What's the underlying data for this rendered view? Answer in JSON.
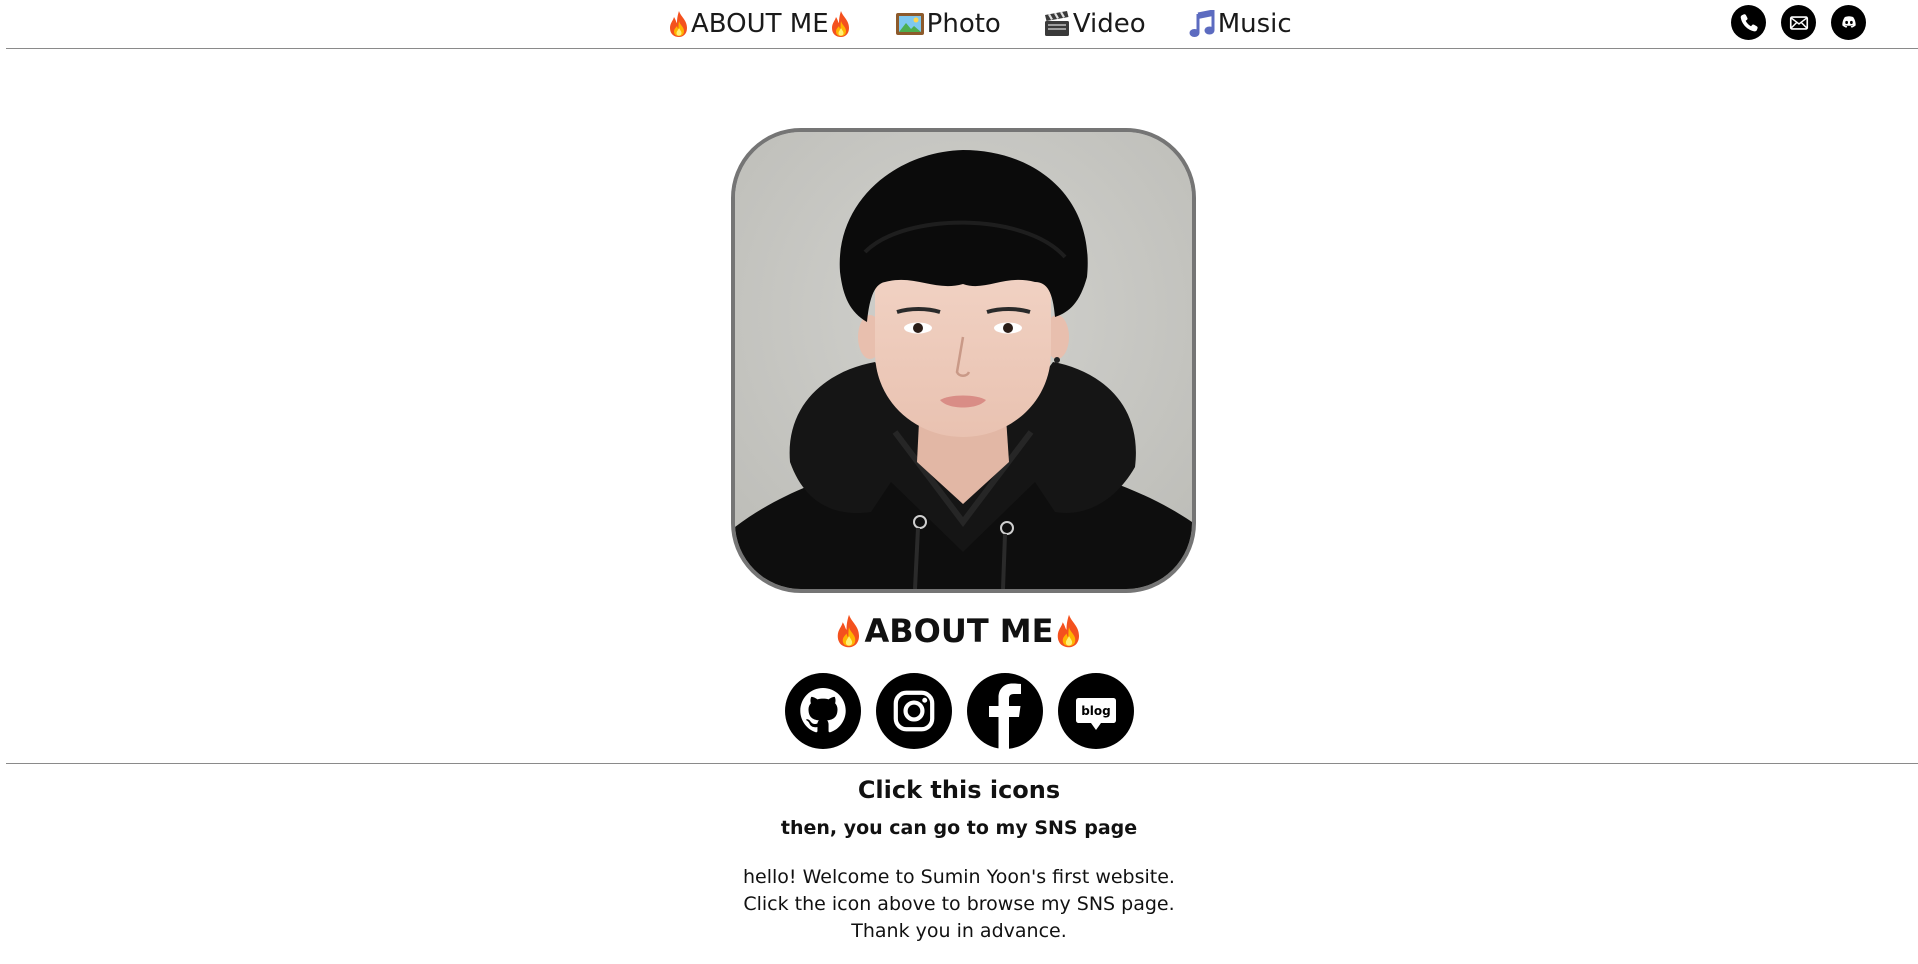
{
  "nav": {
    "items": [
      {
        "label": "ABOUT ME",
        "icon": "fire-icon"
      },
      {
        "label": "Photo",
        "icon": "framed-picture-icon"
      },
      {
        "label": "Video",
        "icon": "clapper-board-icon"
      },
      {
        "label": "Music",
        "icon": "musical-note-icon"
      }
    ],
    "contact_icons": [
      "phone-icon",
      "email-icon",
      "discord-icon"
    ]
  },
  "profile": {
    "photo": "portrait-photo"
  },
  "about": {
    "title": "ABOUT ME",
    "sns_icons": [
      "github-icon",
      "instagram-icon",
      "facebook-icon",
      "blog-icon"
    ],
    "sns_blog_text": "blog"
  },
  "info": {
    "click_title": "Click this icons",
    "click_sub": "then, you can go to my SNS page",
    "welcome_lines": [
      "hello! Welcome to Sumin Yoon's first website.",
      "Click the icon above to browse my SNS page.",
      "Thank you in advance."
    ]
  },
  "colors": {
    "line": "#8a8a8a",
    "icon_bg": "#000000",
    "frame_border": "#757575"
  }
}
